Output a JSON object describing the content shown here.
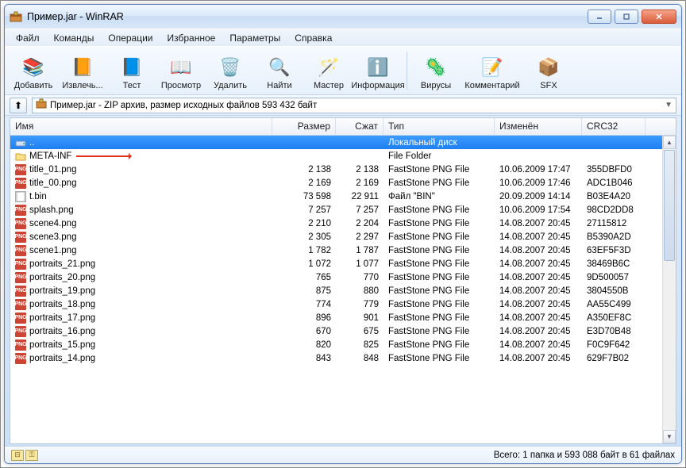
{
  "window": {
    "title": "Пример.jar - WinRAR"
  },
  "menu": {
    "file": "Файл",
    "commands": "Команды",
    "operations": "Операции",
    "favorites": "Избранное",
    "options": "Параметры",
    "help": "Справка"
  },
  "toolbar": {
    "add": "Добавить",
    "extract": "Извлечь...",
    "test": "Тест",
    "view": "Просмотр",
    "delete": "Удалить",
    "find": "Найти",
    "wizard": "Мастер",
    "info": "Информация",
    "virus": "Вирусы",
    "comment": "Комментарий",
    "sfx": "SFX"
  },
  "pathbar": {
    "text": "Пример.jar - ZIP архив, размер исходных файлов 593 432 байт"
  },
  "columns": {
    "name": "Имя",
    "size": "Размер",
    "packed": "Сжат",
    "type": "Тип",
    "modified": "Изменён",
    "crc": "CRC32"
  },
  "parent_row": {
    "name": "..",
    "type": "Локальный диск"
  },
  "folder_row": {
    "name": "META-INF",
    "type": "File Folder"
  },
  "files": [
    {
      "name": "title_01.png",
      "size": "2 138",
      "packed": "2 138",
      "type": "FastStone PNG File",
      "mod": "10.06.2009 17:47",
      "crc": "355DBFD0",
      "icon": "png"
    },
    {
      "name": "title_00.png",
      "size": "2 169",
      "packed": "2 169",
      "type": "FastStone PNG File",
      "mod": "10.06.2009 17:46",
      "crc": "ADC1B046",
      "icon": "png"
    },
    {
      "name": "t.bin",
      "size": "73 598",
      "packed": "22 911",
      "type": "Файл \"BIN\"",
      "mod": "20.09.2009 14:14",
      "crc": "B03E4A20",
      "icon": "bin"
    },
    {
      "name": "splash.png",
      "size": "7 257",
      "packed": "7 257",
      "type": "FastStone PNG File",
      "mod": "10.06.2009 17:54",
      "crc": "98CD2DD8",
      "icon": "png"
    },
    {
      "name": "scene4.png",
      "size": "2 210",
      "packed": "2 204",
      "type": "FastStone PNG File",
      "mod": "14.08.2007 20:45",
      "crc": "27115812",
      "icon": "png"
    },
    {
      "name": "scene3.png",
      "size": "2 305",
      "packed": "2 297",
      "type": "FastStone PNG File",
      "mod": "14.08.2007 20:45",
      "crc": "B5390A2D",
      "icon": "png"
    },
    {
      "name": "scene1.png",
      "size": "1 782",
      "packed": "1 787",
      "type": "FastStone PNG File",
      "mod": "14.08.2007 20:45",
      "crc": "63EF5F3D",
      "icon": "png"
    },
    {
      "name": "portraits_21.png",
      "size": "1 072",
      "packed": "1 077",
      "type": "FastStone PNG File",
      "mod": "14.08.2007 20:45",
      "crc": "38469B6C",
      "icon": "png"
    },
    {
      "name": "portraits_20.png",
      "size": "765",
      "packed": "770",
      "type": "FastStone PNG File",
      "mod": "14.08.2007 20:45",
      "crc": "9D500057",
      "icon": "png"
    },
    {
      "name": "portraits_19.png",
      "size": "875",
      "packed": "880",
      "type": "FastStone PNG File",
      "mod": "14.08.2007 20:45",
      "crc": "3804550B",
      "icon": "png"
    },
    {
      "name": "portraits_18.png",
      "size": "774",
      "packed": "779",
      "type": "FastStone PNG File",
      "mod": "14.08.2007 20:45",
      "crc": "AA55C499",
      "icon": "png"
    },
    {
      "name": "portraits_17.png",
      "size": "896",
      "packed": "901",
      "type": "FastStone PNG File",
      "mod": "14.08.2007 20:45",
      "crc": "A350EF8C",
      "icon": "png"
    },
    {
      "name": "portraits_16.png",
      "size": "670",
      "packed": "675",
      "type": "FastStone PNG File",
      "mod": "14.08.2007 20:45",
      "crc": "E3D70B48",
      "icon": "png"
    },
    {
      "name": "portraits_15.png",
      "size": "820",
      "packed": "825",
      "type": "FastStone PNG File",
      "mod": "14.08.2007 20:45",
      "crc": "F0C9F642",
      "icon": "png"
    },
    {
      "name": "portraits_14.png",
      "size": "843",
      "packed": "848",
      "type": "FastStone PNG File",
      "mod": "14.08.2007 20:45",
      "crc": "629F7B02",
      "icon": "png"
    }
  ],
  "status": {
    "text": "Всего: 1 папка и 593 088 байт в 61 файлах"
  }
}
